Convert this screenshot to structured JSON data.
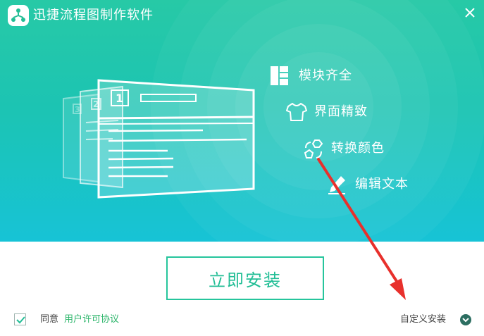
{
  "app": {
    "title": "迅捷流程图制作软件",
    "logo_icon": "flowchart-logo-icon",
    "close_icon": "close-icon"
  },
  "illustration": {
    "page_numbers": [
      "3",
      "2",
      "1"
    ]
  },
  "features": [
    {
      "label": "模块齐全",
      "icon": "module-grid-icon"
    },
    {
      "label": "界面精致",
      "icon": "tshirt-icon"
    },
    {
      "label": "转换颜色",
      "icon": "color-switch-icon"
    },
    {
      "label": "编辑文本",
      "icon": "pencil-icon"
    }
  ],
  "install": {
    "button_label": "立即安装"
  },
  "agreement": {
    "checked": true,
    "prefix": "同意",
    "link_label": "用户许可协议"
  },
  "custom_install": {
    "label": "自定义安装",
    "icon": "chevron-down-circle-icon"
  },
  "colors": {
    "brand_green": "#23be96",
    "hero_top": "#27c9a6",
    "hero_bottom": "#17c3d6",
    "link_green": "#2bb56a",
    "annotation_red": "#e8302c"
  }
}
